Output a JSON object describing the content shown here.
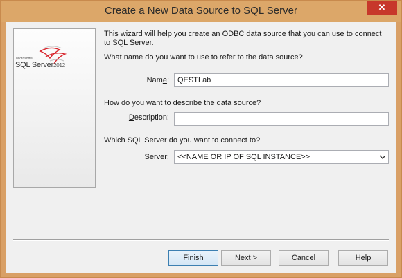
{
  "window": {
    "title": "Create a New Data Source to SQL Server",
    "close_glyph": "✕"
  },
  "banner": {
    "brand_small": "Microsoft®",
    "brand_name": "SQL Server",
    "brand_version": "2012",
    "icon": "sql-server-logo-icon",
    "accent_color": "#d8232a"
  },
  "content": {
    "intro": "This wizard will help you create an ODBC data source that you can use to connect to SQL Server.",
    "question_name": "What name do you want to use to refer to the data source?",
    "question_description": "How do you want to describe the data source?",
    "question_server": "Which SQL Server do you want to connect to?"
  },
  "fields": {
    "name_label_underlined": "e",
    "name_label_pre": "Nam",
    "name_label_post": ":",
    "name_value": "QESTLab",
    "description_label_pre": "",
    "description_label_underlined": "D",
    "description_label_post": "escription:",
    "description_value": "",
    "server_label_pre": "",
    "server_label_underlined": "S",
    "server_label_post": "erver:",
    "server_value": "<<NAME OR IP OF SQL INSTANCE>>"
  },
  "buttons": {
    "finish": "Finish",
    "next_underlined": "N",
    "next_post": "ext >",
    "cancel": "Cancel",
    "help": "Help"
  }
}
